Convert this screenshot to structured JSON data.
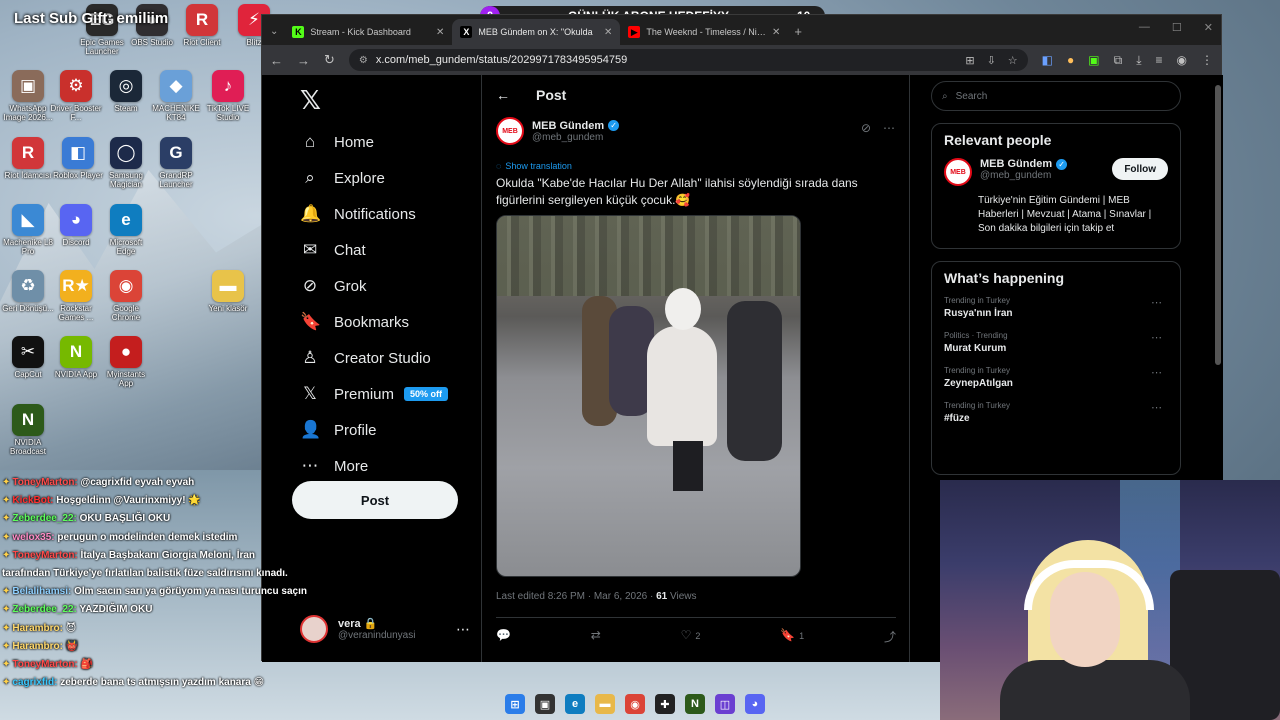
{
  "overlay": {
    "gift_banner": "Last Sub Gift: emiliim",
    "goal": {
      "title": "GÜNLÜK ABONE HEDEFİYY",
      "current": "0",
      "target": "10"
    }
  },
  "desktop_icons": [
    {
      "label": "Epic Games Launcher",
      "glyph": "EG",
      "color": "#2a2a2a"
    },
    {
      "label": "OBS Studio",
      "glyph": "●",
      "color": "#302e31"
    },
    {
      "label": "Riot Client",
      "glyph": "R",
      "color": "#d13639"
    },
    {
      "label": "Blitz",
      "glyph": "⚡",
      "color": "#e0243b"
    },
    {
      "label": "WhatsApp Image 2026...",
      "glyph": "▣",
      "color": "#8a6b5a"
    },
    {
      "label": "Driver Booster F...",
      "glyph": "⚙",
      "color": "#c9302c"
    },
    {
      "label": "Steam",
      "glyph": "◎",
      "color": "#1b2838"
    },
    {
      "label": "MACHENIKE KT84",
      "glyph": "◆",
      "color": "#6aa0d8"
    },
    {
      "label": "TikTok LIVE Studio",
      "glyph": "♪",
      "color": "#e01e55"
    },
    {
      "label": "Riot İdamcısı",
      "glyph": "R",
      "color": "#d13639"
    },
    {
      "label": "Roblox Player",
      "glyph": "◧",
      "color": "#3a7bd5"
    },
    {
      "label": "Samsung Magician",
      "glyph": "◯",
      "color": "#1d2a4a"
    },
    {
      "label": "GrandRP Launcher",
      "glyph": "G",
      "color": "#2b3e66"
    },
    {
      "label": "Machenike L8 Pro",
      "glyph": "◣",
      "color": "#3b89d4"
    },
    {
      "label": "Discord",
      "glyph": "◕",
      "color": "#5865f2"
    },
    {
      "label": "Microsoft Edge",
      "glyph": "e",
      "color": "#0f7dc0"
    },
    {
      "label": "Geri Dönüşü...",
      "glyph": "♻",
      "color": "#6f8fa8"
    },
    {
      "label": "Rockstar Games ...",
      "glyph": "R★",
      "color": "#f2b01e"
    },
    {
      "label": "Google Chrome",
      "glyph": "◉",
      "color": "#db4437"
    },
    {
      "label": "Yeni klasör",
      "glyph": "▬",
      "color": "#e8c34a"
    },
    {
      "label": "CapCut",
      "glyph": "✂",
      "color": "#111111"
    },
    {
      "label": "NVIDIA App",
      "glyph": "N",
      "color": "#76b900"
    },
    {
      "label": "Myinstants App",
      "glyph": "●",
      "color": "#c41e1e"
    },
    {
      "label": "NVIDIA Broadcast",
      "glyph": "N",
      "color": "#2d5a1a"
    }
  ],
  "browser": {
    "tabs": [
      {
        "title": "Stream - Kick Dashboard",
        "favicon": "K",
        "color": "#53fc18",
        "active": false
      },
      {
        "title": "MEB Gündem on X: \"Okulda",
        "favicon": "X",
        "color": "#000000",
        "active": true
      },
      {
        "title": "The Weeknd - Timeless / Niagara",
        "favicon": "▶",
        "color": "#ff0000",
        "active": false
      }
    ],
    "url": "x.com/meb_gundem/status/2029971783495954759"
  },
  "nav": {
    "items": [
      {
        "label": "Home",
        "icon": "home-icon",
        "glyph": "⌂"
      },
      {
        "label": "Explore",
        "icon": "search-icon",
        "glyph": "⌕"
      },
      {
        "label": "Notifications",
        "icon": "bell-icon",
        "glyph": "🔔"
      },
      {
        "label": "Chat",
        "icon": "mail-icon",
        "glyph": "✉"
      },
      {
        "label": "Grok",
        "icon": "grok-icon",
        "glyph": "⊘"
      },
      {
        "label": "Bookmarks",
        "icon": "bookmark-icon",
        "glyph": "🔖"
      },
      {
        "label": "Creator Studio",
        "icon": "creator-icon",
        "glyph": "♙"
      },
      {
        "label": "Premium",
        "icon": "x-premium-icon",
        "glyph": "𝕏"
      },
      {
        "label": "Profile",
        "icon": "person-icon",
        "glyph": "👤"
      },
      {
        "label": "More",
        "icon": "more-icon",
        "glyph": "⋯"
      }
    ],
    "premium_badge": "50% off",
    "post_button": "Post",
    "account": {
      "name": "vera 🔒",
      "handle": "@veranindunyasi"
    }
  },
  "post": {
    "header": "Post",
    "author": {
      "name": "MEB Gündem",
      "handle": "@meb_gundem"
    },
    "show_translation": "Show translation",
    "text": "Okulda \"Kabe'de Hacılar Hu Der Allah\" ilahisi söylendiği sırada dans figürlerini sergileyen küçük çocuk.🥰",
    "meta": {
      "edited": "Last edited 8:26 PM · Mar 6, 2026 · ",
      "views_count": "61",
      "views_label": " Views"
    },
    "actions": {
      "reply": "",
      "repost": "",
      "likes": "2",
      "bookmarks": "1"
    }
  },
  "sidebar": {
    "search_placeholder": "Search",
    "relevant_title": "Relevant people",
    "person": {
      "name": "MEB Gündem",
      "handle": "@meb_gundem",
      "follow": "Follow",
      "bio": "Türkiye'nin Eğitim Gündemi | MEB Haberleri | Mevzuat | Atama | Sınavlar | Son dakika bilgileri için takip et"
    },
    "happening_title": "What’s happening",
    "trends": [
      {
        "context": "Trending in Turkey",
        "title": "Rusya'nın İran"
      },
      {
        "context": "Politics · Trending",
        "title": "Murat Kurum"
      },
      {
        "context": "Trending in Turkey",
        "title": "ZeynepAtılgan"
      },
      {
        "context": "Trending in Turkey",
        "title": "#füze"
      }
    ]
  },
  "chat": [
    {
      "user": "ToneyMarton:",
      "color": "#ff4a4a",
      "text": "@cagrixfid eyvah eyvah"
    },
    {
      "user": "KickBot:",
      "color": "#ff3030",
      "text": "Hoşgeldinn @Vaurinxmiyy! 🌟"
    },
    {
      "user": "Zeberdee_22:",
      "color": "#5dff5d",
      "text": "OKU BAŞLIĞI OKU"
    },
    {
      "user": "welox35:",
      "color": "#ff8cc6",
      "text": "perugun o modelinden demek istedim"
    },
    {
      "user": "ToneyMarton:",
      "color": "#ff4a4a",
      "text": "İtalya Başbakanı Giorgia Meloni, İran"
    },
    {
      "user": "",
      "color": "#ffffff",
      "text": "tarafından Türkiye'ye fırlatılan balistik füze saldırısını kınadı."
    },
    {
      "user": "Belalihamsi:",
      "color": "#8fd0ff",
      "text": "Olm sacın sarı ya görüyom ya nası turuncu saçın"
    },
    {
      "user": "Zeberdee_22:",
      "color": "#5dff5d",
      "text": "YAZDIĞIM OKU"
    },
    {
      "user": "Harambro:",
      "color": "#ffd86b",
      "text": "😈"
    },
    {
      "user": "Harambro:",
      "color": "#ffd86b",
      "text": "👹"
    },
    {
      "user": "ToneyMarton:",
      "color": "#ff4a4a",
      "text": "🎒"
    },
    {
      "user": "cagrixfid:",
      "color": "#38c8ff",
      "text": "zeberde bana ts atmışsın yazdım kanara 😁"
    }
  ]
}
